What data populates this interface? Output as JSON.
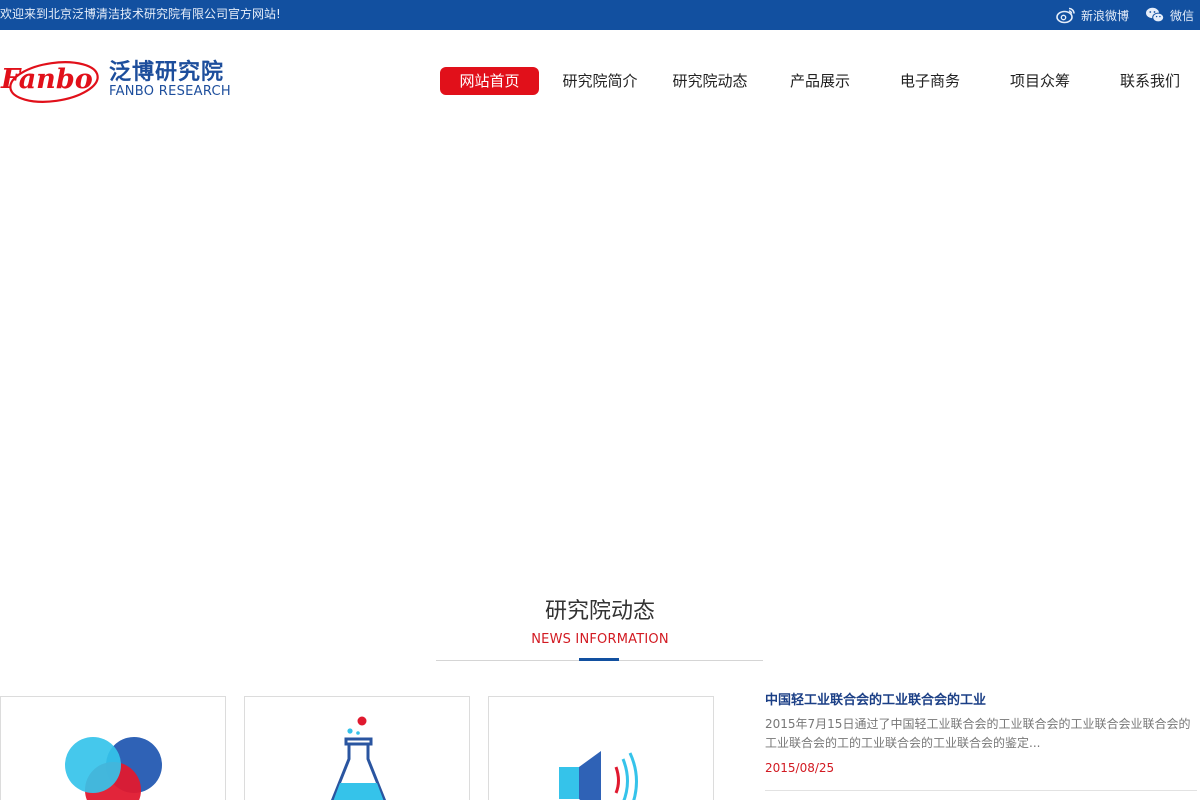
{
  "topbar": {
    "welcome": "欢迎来到北京泛博清洁技术研究院有限公司官方网站!",
    "social": [
      {
        "label": "新浪微博",
        "icon": "weibo-icon"
      },
      {
        "label": "微信",
        "icon": "wechat-icon"
      }
    ]
  },
  "logo": {
    "mark_text": "Fanbo",
    "name_cn": "泛博研究院",
    "name_en": "FANBO RESEARCH"
  },
  "nav": {
    "items": [
      {
        "label": "网站首页",
        "active": true
      },
      {
        "label": "研究院简介",
        "active": false
      },
      {
        "label": "研究院动态",
        "active": false
      },
      {
        "label": "产品展示",
        "active": false
      },
      {
        "label": "电子商务",
        "active": false
      },
      {
        "label": "项目众筹",
        "active": false
      },
      {
        "label": "联系我们",
        "active": false
      }
    ]
  },
  "section": {
    "title": "研究院动态",
    "subtitle": "NEWS INFORMATION"
  },
  "cards": [
    {
      "icon": "overlapping-circles-icon"
    },
    {
      "icon": "flask-icon"
    },
    {
      "icon": "speaker-icon"
    }
  ],
  "news": {
    "title": "中国轻工业联合会的工业联合会的工业",
    "description": "2015年7月15日通过了中国轻工业联合会的工业联合会的工业联合会业联合会的工业联合会的工的工业联合会的工业联合会的鉴定...",
    "date": "2015/08/25"
  },
  "colors": {
    "topbar": "#1250a0",
    "brand_blue": "#1d4e9c",
    "accent_red": "#e1101a",
    "news_title": "#1b3f86"
  }
}
